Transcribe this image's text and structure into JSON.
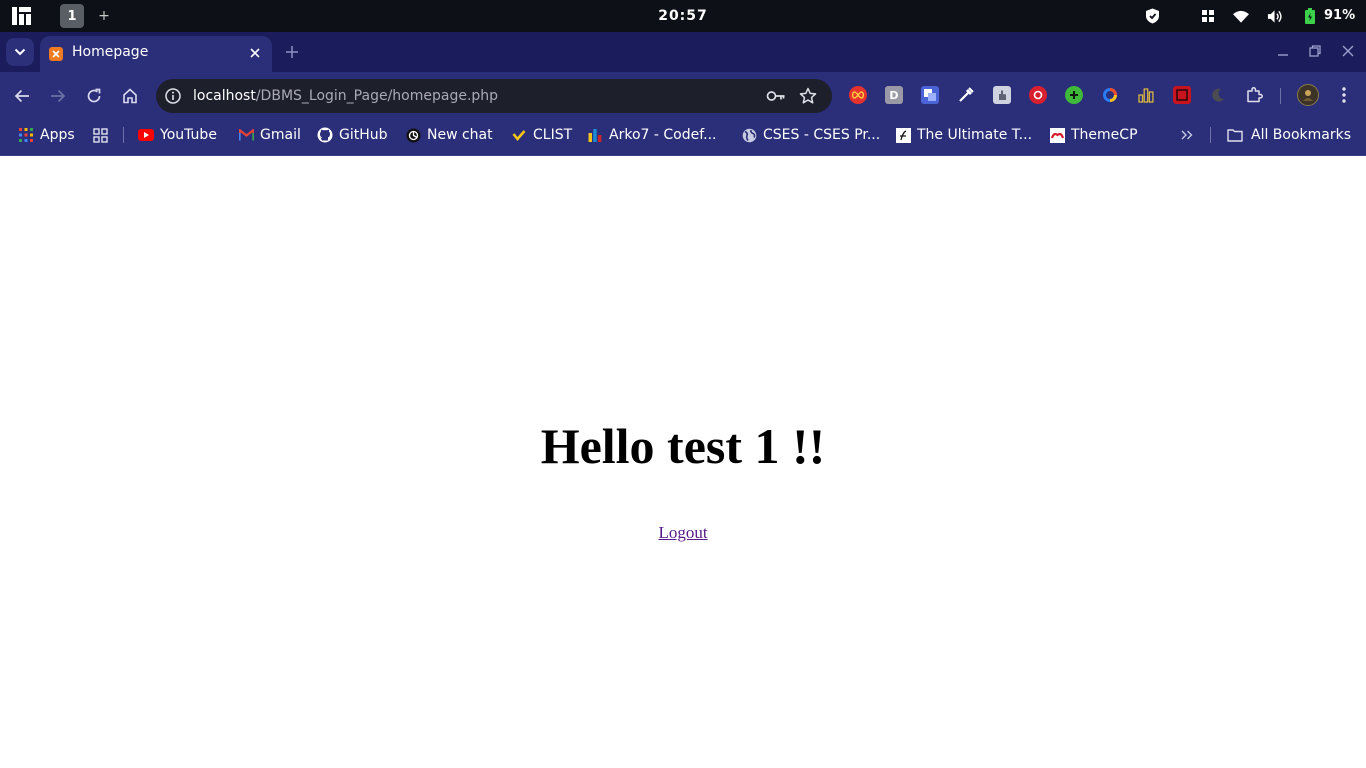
{
  "os_bar": {
    "workspace": "1",
    "add_workspace": "+",
    "clock": "20:57",
    "battery": "91%"
  },
  "tab": {
    "title": "Homepage"
  },
  "omnibox": {
    "host": "localhost",
    "path": "/DBMS_Login_Page/homepage.php"
  },
  "extensions": {
    "d_label": "D"
  },
  "bookmarks": [
    {
      "label": "Apps"
    },
    {
      "label": "YouTube"
    },
    {
      "label": "Gmail"
    },
    {
      "label": "GitHub"
    },
    {
      "label": "New chat"
    },
    {
      "label": "CLIST"
    },
    {
      "label": "Arko7 - Codef..."
    },
    {
      "label": "CSES - CSES Pr..."
    },
    {
      "label": "The Ultimate T..."
    },
    {
      "label": "ThemeCP"
    },
    {
      "label": "All Bookmarks"
    }
  ],
  "page": {
    "heading": "Hello test 1 !!",
    "logout_link": "Logout"
  },
  "colors": {
    "tab_strip": "#1a1c5c",
    "toolbar": "#2b2e78",
    "os_bar": "#0d1117",
    "visited_link": "#551a8b"
  }
}
